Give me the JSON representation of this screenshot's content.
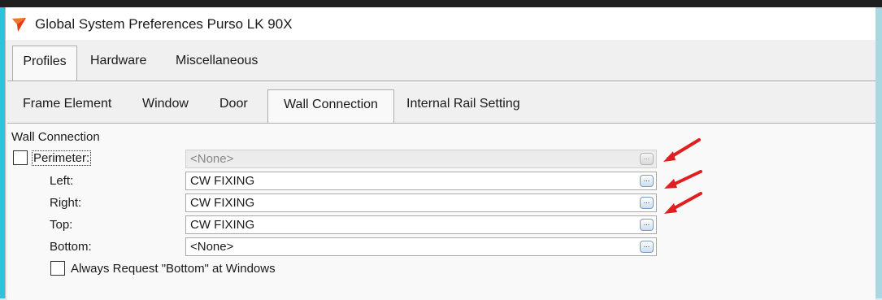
{
  "window": {
    "title": "Global System Preferences Purso LK 90X"
  },
  "main_tabs": [
    {
      "label": "Profiles",
      "active": true
    },
    {
      "label": "Hardware",
      "active": false
    },
    {
      "label": "Miscellaneous",
      "active": false
    }
  ],
  "sub_tabs": [
    {
      "label": "Frame Element",
      "active": false
    },
    {
      "label": "Window",
      "active": false
    },
    {
      "label": "Door",
      "active": false
    },
    {
      "label": "Wall Connection",
      "active": true
    },
    {
      "label": "Internal Rail Setting",
      "active": false
    }
  ],
  "wall_connection": {
    "group_title": "Wall Connection",
    "perimeter": {
      "label": "Perimeter:",
      "checked": false,
      "value": "<None>",
      "button_label": "..."
    },
    "left": {
      "label": "Left:",
      "value": "CW FIXING",
      "button_label": "..."
    },
    "right": {
      "label": "Right:",
      "value": "CW FIXING",
      "button_label": "..."
    },
    "top": {
      "label": "Top:",
      "value": "CW FIXING",
      "button_label": "..."
    },
    "bottom": {
      "label": "Bottom:",
      "value": "<None>",
      "button_label": "..."
    },
    "always_request": {
      "label": "Always Request \"Bottom\" at Windows",
      "checked": false
    }
  },
  "colors": {
    "arrow": "#e02020",
    "accent": "#2ec3d6"
  }
}
